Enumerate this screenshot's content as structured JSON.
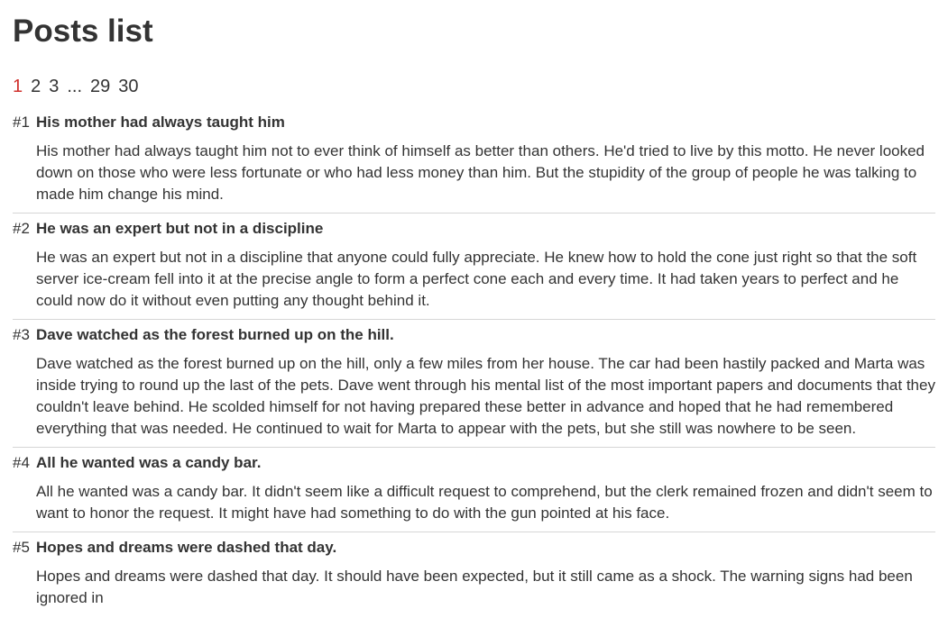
{
  "page": {
    "title": "Posts list"
  },
  "pagination": {
    "items": [
      "1",
      "2",
      "3",
      "...",
      "29",
      "30"
    ],
    "active": "1"
  },
  "posts": [
    {
      "number": "#1",
      "title": "His mother had always taught him",
      "body": "His mother had always taught him not to ever think of himself as better than others. He'd tried to live by this motto. He never looked down on those who were less fortunate or who had less money than him. But the stupidity of the group of people he was talking to made him change his mind."
    },
    {
      "number": "#2",
      "title": "He was an expert but not in a discipline",
      "body": "He was an expert but not in a discipline that anyone could fully appreciate. He knew how to hold the cone just right so that the soft server ice-cream fell into it at the precise angle to form a perfect cone each and every time. It had taken years to perfect and he could now do it without even putting any thought behind it."
    },
    {
      "number": "#3",
      "title": "Dave watched as the forest burned up on the hill.",
      "body": "Dave watched as the forest burned up on the hill, only a few miles from her house. The car had been hastily packed and Marta was inside trying to round up the last of the pets. Dave went through his mental list of the most important papers and documents that they couldn't leave behind. He scolded himself for not having prepared these better in advance and hoped that he had remembered everything that was needed. He continued to wait for Marta to appear with the pets, but she still was nowhere to be seen."
    },
    {
      "number": "#4",
      "title": "All he wanted was a candy bar.",
      "body": "All he wanted was a candy bar. It didn't seem like a difficult request to comprehend, but the clerk remained frozen and didn't seem to want to honor the request. It might have had something to do with the gun pointed at his face."
    },
    {
      "number": "#5",
      "title": "Hopes and dreams were dashed that day.",
      "body": "Hopes and dreams were dashed that day. It should have been expected, but it still came as a shock. The warning signs had been ignored in"
    }
  ],
  "colors": {
    "text": "#333333",
    "active_page": "#d0312d",
    "divider": "#d6d6d6"
  }
}
